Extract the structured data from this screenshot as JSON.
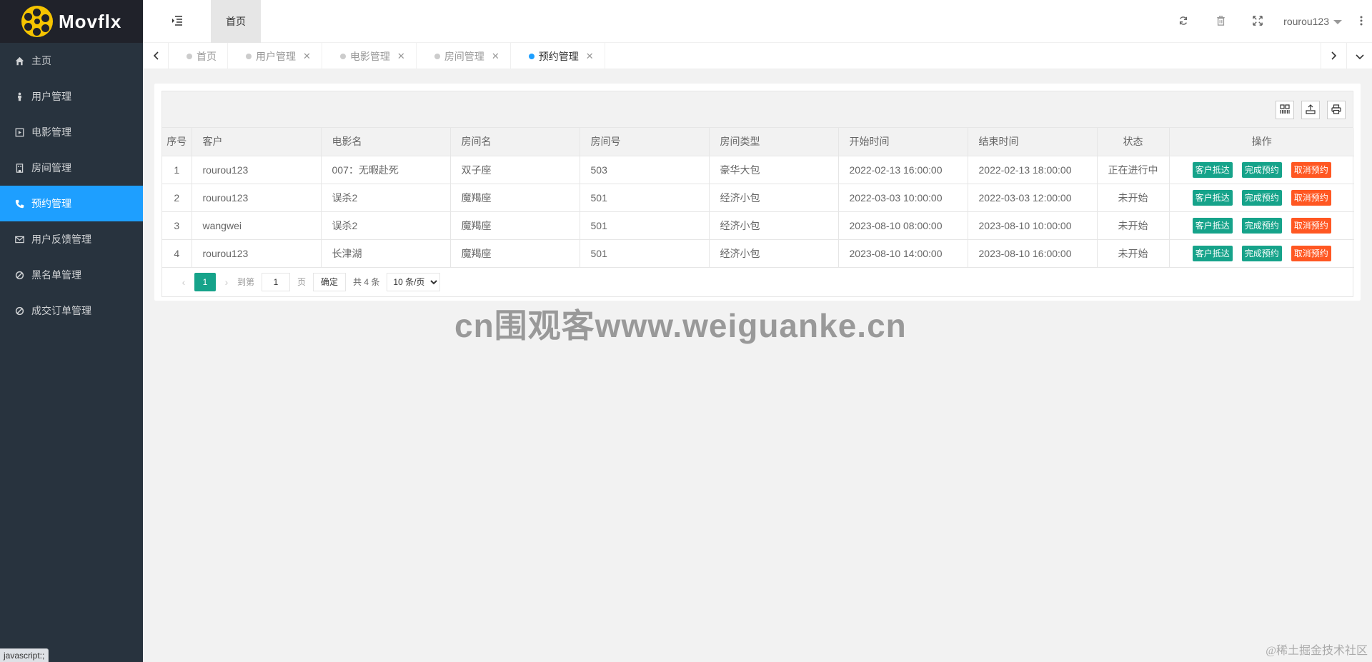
{
  "app": {
    "logo_text": "Movflx"
  },
  "sidebar": {
    "items": [
      {
        "label": "主页",
        "icon": "home-icon",
        "active": false
      },
      {
        "label": "用户管理",
        "icon": "person-icon",
        "active": false
      },
      {
        "label": "电影管理",
        "icon": "play-square-icon",
        "active": false
      },
      {
        "label": "房间管理",
        "icon": "building-icon",
        "active": false
      },
      {
        "label": "预约管理",
        "icon": "phone-icon",
        "active": true
      },
      {
        "label": "用户反馈管理",
        "icon": "envelope-icon",
        "active": false
      },
      {
        "label": "黑名单管理",
        "icon": "ban-icon",
        "active": false
      },
      {
        "label": "成交订单管理",
        "icon": "ban-icon",
        "active": false
      }
    ]
  },
  "header": {
    "home_tab": "首页",
    "username": "rourou123"
  },
  "tabs": [
    {
      "label": "首页",
      "closable": false,
      "active": false
    },
    {
      "label": "用户管理",
      "closable": true,
      "active": false
    },
    {
      "label": "电影管理",
      "closable": true,
      "active": false
    },
    {
      "label": "房间管理",
      "closable": true,
      "active": false
    },
    {
      "label": "预约管理",
      "closable": true,
      "active": true
    }
  ],
  "table": {
    "columns": [
      "序号",
      "客户",
      "电影名",
      "房间名",
      "房间号",
      "房间类型",
      "开始时间",
      "结束时间",
      "状态",
      "操作"
    ],
    "rows": [
      {
        "idx": "1",
        "customer": "rourou123",
        "movie": "007：无暇赴死",
        "room_name": "双子座",
        "room_no": "503",
        "room_type": "豪华大包",
        "start": "2022-02-13 16:00:00",
        "end": "2022-02-13 18:00:00",
        "status": "正在进行中"
      },
      {
        "idx": "2",
        "customer": "rourou123",
        "movie": "误杀2",
        "room_name": "魔羯座",
        "room_no": "501",
        "room_type": "经济小包",
        "start": "2022-03-03 10:00:00",
        "end": "2022-03-03 12:00:00",
        "status": "未开始"
      },
      {
        "idx": "3",
        "customer": "wangwei",
        "movie": "误杀2",
        "room_name": "魔羯座",
        "room_no": "501",
        "room_type": "经济小包",
        "start": "2023-08-10 08:00:00",
        "end": "2023-08-10 10:00:00",
        "status": "未开始"
      },
      {
        "idx": "4",
        "customer": "rourou123",
        "movie": "长津湖",
        "room_name": "魔羯座",
        "room_no": "501",
        "room_type": "经济小包",
        "start": "2023-08-10 14:00:00",
        "end": "2023-08-10 16:00:00",
        "status": "未开始"
      }
    ],
    "actions": {
      "arrive": "客户抵达",
      "complete": "完成预约",
      "cancel": "取消预约"
    }
  },
  "pager": {
    "current_page": "1",
    "goto_label": "到第",
    "goto_value": "1",
    "page_suffix": "页",
    "confirm": "确定",
    "total": "共 4 条",
    "page_size": "10 条/页"
  },
  "overlay": {
    "watermark": "cn围观客www.weiguanke.cn",
    "credit": "@稀土掘金技术社区",
    "status_bar": "javascript:;"
  },
  "colors": {
    "sidebar_bg": "#28333e",
    "active_blue": "#1e9fff",
    "btn_green": "#16a38a",
    "btn_orange": "#ff5722"
  }
}
